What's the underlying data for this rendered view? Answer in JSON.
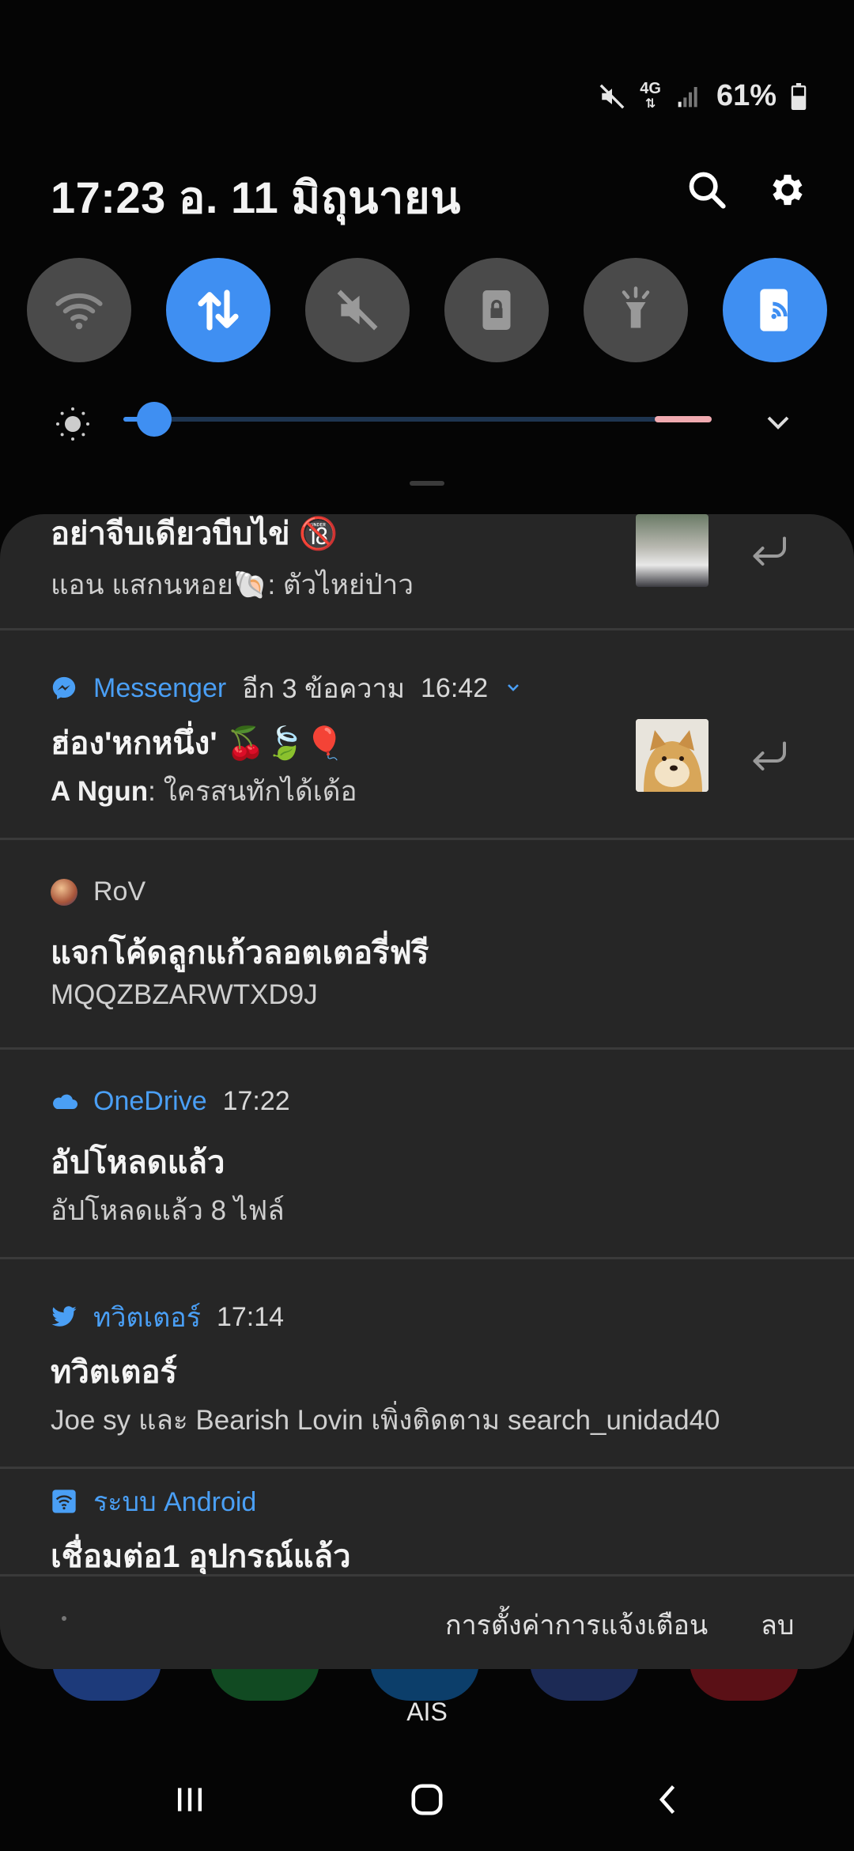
{
  "status_bar": {
    "network": "4G",
    "battery": "61%"
  },
  "header": {
    "datetime": "17:23  อ. 11 มิถุนายน"
  },
  "quick_settings": [
    {
      "name": "wifi",
      "on": false
    },
    {
      "name": "mobile-data",
      "on": true
    },
    {
      "name": "sound",
      "on": false
    },
    {
      "name": "screen-lock",
      "on": false
    },
    {
      "name": "flashlight",
      "on": false
    },
    {
      "name": "hotspot",
      "on": true
    }
  ],
  "brightness": {
    "level": 0.05
  },
  "notifications": {
    "line_partial": {
      "title": "อย่าจีบเดียวบีบไข่ 🔞",
      "body": "แอน แสกนหอย🐚: ตัวไหย่ป่าว"
    },
    "messenger": {
      "app": "Messenger",
      "extra": "อีก 3 ข้อความ",
      "time": "16:42",
      "title": "ฮ่อง'หกหนึ่ง' 🍒🍃🎈",
      "sender": "A Ngun",
      "body": ": ใครสนทักได้เด้อ"
    },
    "rov": {
      "app": "RoV",
      "title": "แจกโค้ดลูกแก้วลอตเตอรี่ฟรี",
      "body": "MQQZBZARWTXD9J"
    },
    "onedrive": {
      "app": "OneDrive",
      "time": "17:22",
      "title": "อัปโหลดแล้ว",
      "body": "อัปโหลดแล้ว 8 ไฟล์"
    },
    "twitter": {
      "app": "ทวิตเตอร์",
      "time": "17:14",
      "title": "ทวิตเตอร์",
      "body": "Joe sy และ Bearish Lovin เพิ่งติดตาม search_unidad40"
    },
    "android": {
      "app": "ระบบ Android",
      "title": "เชื่อมต่อ1 อุปกรณ์แล้ว"
    }
  },
  "panel_footer": {
    "settings_label": "การตั้งค่าการแจ้งเตือน",
    "clear_label": "ลบ"
  },
  "carrier": "AIS",
  "colors": {
    "accent": "#3f8ff2",
    "panel": "#262626",
    "app_name": "#4a9ff5"
  }
}
